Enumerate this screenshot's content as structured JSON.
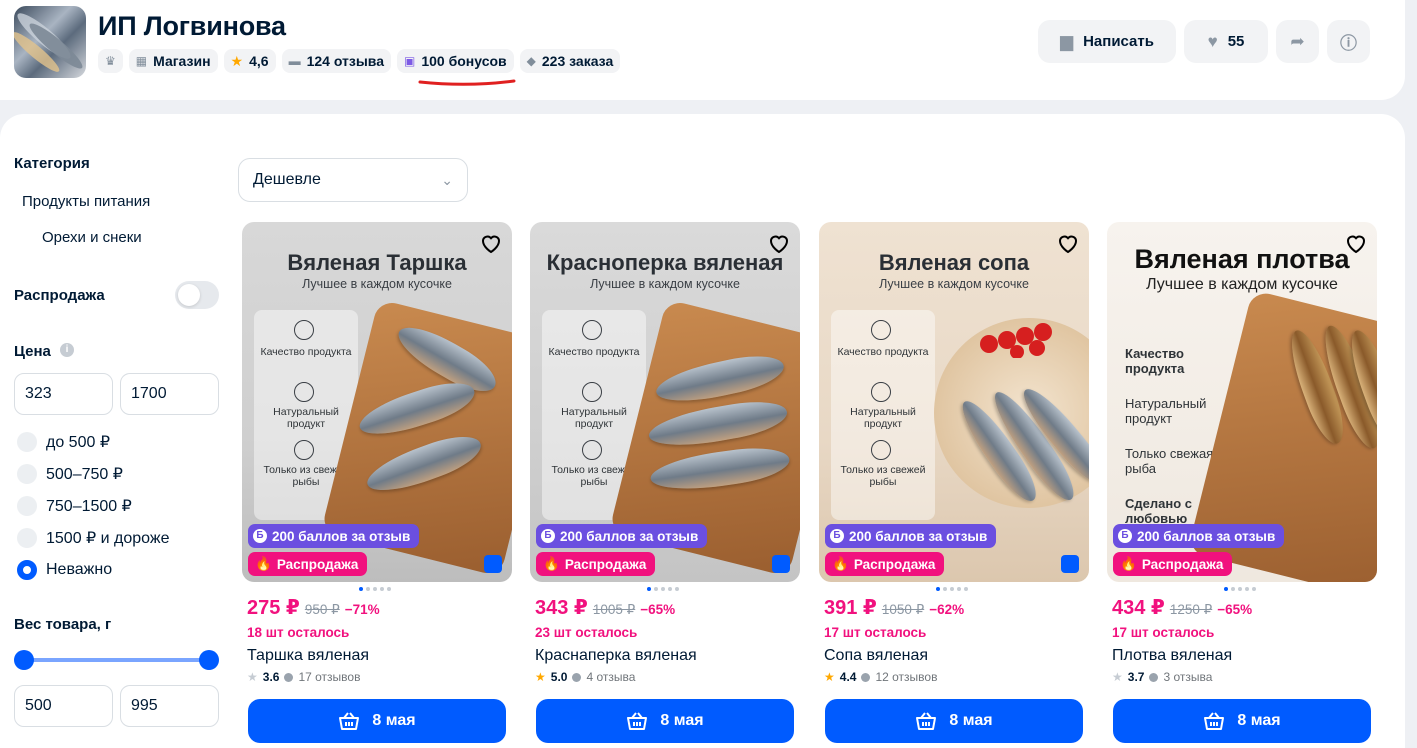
{
  "shop": {
    "name": "ИП Логвинова",
    "chips": {
      "type": "Магазин",
      "rating": "4,6",
      "reviews": "124 отзыва",
      "bonuses": "100 бонусов",
      "orders": "223 заказа"
    },
    "actions": {
      "write": "Написать",
      "likes": "55"
    }
  },
  "colors": {
    "accent": "#005bff",
    "sale": "#f1117e",
    "bonus": "#6b4fe0",
    "rating_star": "#ffa800"
  },
  "sidebar": {
    "category_title": "Категория",
    "category_items": [
      "Продукты питания",
      "Орехи и снеки"
    ],
    "sale_label": "Распродажа",
    "price_title": "Цена",
    "price_from": "323",
    "price_to": "1700",
    "price_options": [
      "до 500 ₽",
      "500–750 ₽",
      "750–1500 ₽",
      "1500 ₽ и дороже",
      "Неважно"
    ],
    "price_selected": "Неважно",
    "weight_title": "Вес товара, г",
    "weight_from": "500",
    "weight_to": "995"
  },
  "sort": {
    "selected": "Дешевле"
  },
  "products": [
    {
      "image_title": "Вяленая Таршка",
      "image_subtitle": "Лучшее в каждом кусочке",
      "features": [
        "Качество продукта",
        "Натуральный продукт",
        "Только из свежей рыбы"
      ],
      "bonus_badge": "200 баллов за отзыв",
      "sale_badge": "Распродажа",
      "price": "275 ₽",
      "old_price": "950 ₽",
      "discount": "−71%",
      "stock": "18 шт осталось",
      "name": "Таршка вяленая",
      "rating": "3.6",
      "reviews": "17 отзывов",
      "delivery": "8 мая",
      "star_color": "#c6ccd3"
    },
    {
      "image_title": "Красноперка вяленая",
      "image_subtitle": "Лучшее в каждом кусочке",
      "features": [
        "Качество продукта",
        "Натуральный продукт",
        "Только из свежей рыбы"
      ],
      "bonus_badge": "200 баллов за отзыв",
      "sale_badge": "Распродажа",
      "price": "343 ₽",
      "old_price": "1005 ₽",
      "discount": "−65%",
      "stock": "23 шт осталось",
      "name": "Краснаперка вяленая",
      "rating": "5.0",
      "reviews": "4 отзыва",
      "delivery": "8 мая",
      "star_color": "#ffa800"
    },
    {
      "image_title": "Вяленая сопа",
      "image_subtitle": "Лучшее в каждом кусочке",
      "features": [
        "Качество продукта",
        "Натуральный продукт",
        "Только из свежей рыбы"
      ],
      "bonus_badge": "200 баллов за отзыв",
      "sale_badge": "Распродажа",
      "price": "391 ₽",
      "old_price": "1050 ₽",
      "discount": "−62%",
      "stock": "17 шт осталось",
      "name": "Сопа вяленая",
      "rating": "4.4",
      "reviews": "12 отзывов",
      "delivery": "8 мая",
      "star_color": "#ffa800"
    },
    {
      "image_title": "Вяленая плотва",
      "image_subtitle": "Лучшее в каждом кусочке",
      "features": [
        "Качество продукта",
        "Натуральный продукт",
        "Только свежая рыба",
        "Сделано с любовью"
      ],
      "bonus_badge": "200 баллов за отзыв",
      "sale_badge": "Распродажа",
      "price": "434 ₽",
      "old_price": "1250 ₽",
      "discount": "−65%",
      "stock": "17 шт осталось",
      "name": "Плотва вяленая",
      "rating": "3.7",
      "reviews": "3 отзыва",
      "delivery": "8 мая",
      "star_color": "#c6ccd3"
    }
  ]
}
